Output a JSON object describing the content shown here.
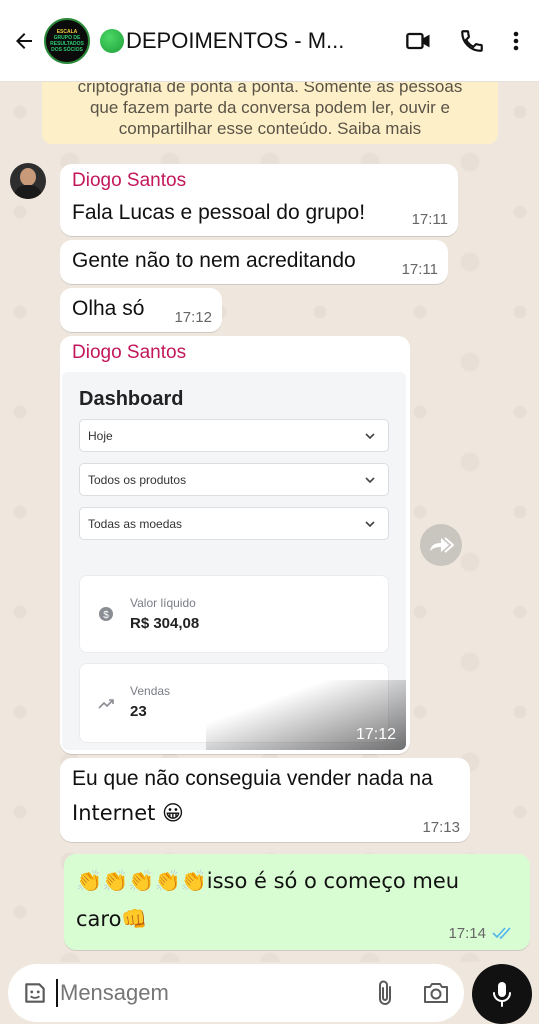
{
  "header": {
    "title": "DEPOIMENTOS - M...",
    "avatar_lines": [
      "ESCALA",
      "GRUPO DE",
      "RESULTADOS",
      "DOS SÓCIOS"
    ]
  },
  "encryption_notice": {
    "line1": "criptografia de ponta a ponta. Somente as pessoas",
    "line2": "que fazem parte da conversa podem ler, ouvir e",
    "line3": "compartilhar esse conteúdo. Saiba mais"
  },
  "messages": [
    {
      "sender": "Diogo Santos",
      "text": "Fala Lucas e pessoal do grupo!",
      "time": "17:11"
    },
    {
      "text": "Gente não to nem acreditando",
      "time": "17:11"
    },
    {
      "text": "Olha só",
      "time": "17:12"
    },
    {
      "sender": "Diogo Santos",
      "time": "17:12"
    },
    {
      "line1": "Eu que não conseguia vender nada na",
      "line2": "Internet 😀",
      "time": "17:13"
    },
    {
      "line1": "👏👏👏👏👏isso é só o começo meu",
      "line2": "caro👊",
      "time": "17:14"
    }
  ],
  "dashboard": {
    "title": "Dashboard",
    "filters": [
      "Hoje",
      "Todos os produtos",
      "Todas as moedas"
    ],
    "cards": [
      {
        "label": "Valor líquido",
        "value": "R$ 304,08",
        "icon": "dollar-icon"
      },
      {
        "label": "Vendas",
        "value": "23",
        "icon": "trend-icon"
      }
    ]
  },
  "input": {
    "placeholder": "Mensagem"
  },
  "colors": {
    "sender": "#c2185b",
    "outgoing": "#d9fdd3",
    "read_ticks": "#4fb6ec"
  }
}
